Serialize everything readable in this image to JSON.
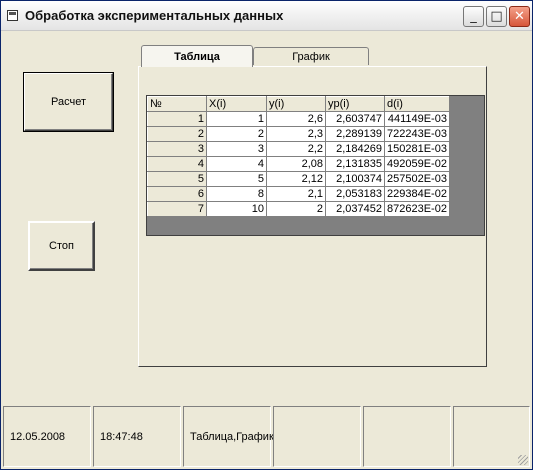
{
  "window": {
    "title": "Обработка экспериментальных данных"
  },
  "buttons": {
    "calc": "Расчет",
    "stop": "Стоп"
  },
  "tabs": [
    {
      "label": "Таблица"
    },
    {
      "label": "График"
    }
  ],
  "table": {
    "headers": [
      "№",
      "X(i)",
      "y(i)",
      "yp(i)",
      "d(i)"
    ],
    "rows": [
      [
        "1",
        "1",
        "2,6",
        "2,603747",
        "441149E-03"
      ],
      [
        "2",
        "2",
        "2,3",
        "2,289139",
        "722243E-03"
      ],
      [
        "3",
        "3",
        "2,2",
        "2,184269",
        "150281E-03"
      ],
      [
        "4",
        "4",
        "2,08",
        "2,131835",
        "492059E-02"
      ],
      [
        "5",
        "5",
        "2,12",
        "2,100374",
        "257502E-03"
      ],
      [
        "6",
        "8",
        "2,1",
        "2,053183",
        "229384E-02"
      ],
      [
        "7",
        "10",
        "2",
        "2,037452",
        "872623E-02"
      ]
    ]
  },
  "status": {
    "date": "12.05.2008",
    "time": "18:47:48",
    "mode": "Таблица,График"
  },
  "icons": {
    "app": "app-icon",
    "minimize": "minimize-icon",
    "maximize": "maximize-icon",
    "close": "close-icon"
  }
}
